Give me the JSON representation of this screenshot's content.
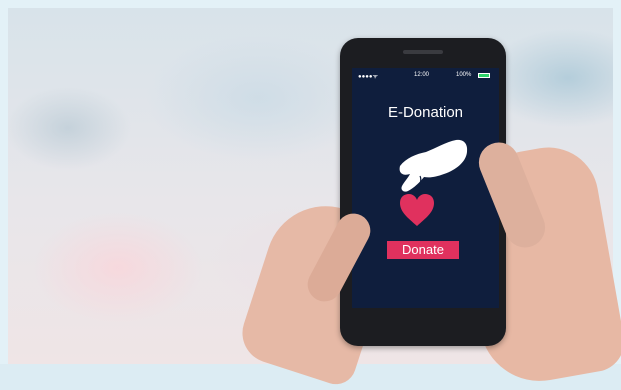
{
  "app": {
    "title": "E-Donation",
    "button_label": "Donate"
  },
  "statusbar": {
    "signal": "●●●●ᯤ",
    "time": "12:00",
    "battery": "100%"
  },
  "colors": {
    "screen_background": "#0f1e3d",
    "button": "#e0315e",
    "heart": "#e0315e",
    "battery": "#2fd36b"
  },
  "icons": [
    "hand-icon",
    "heart-icon",
    "battery-icon"
  ]
}
